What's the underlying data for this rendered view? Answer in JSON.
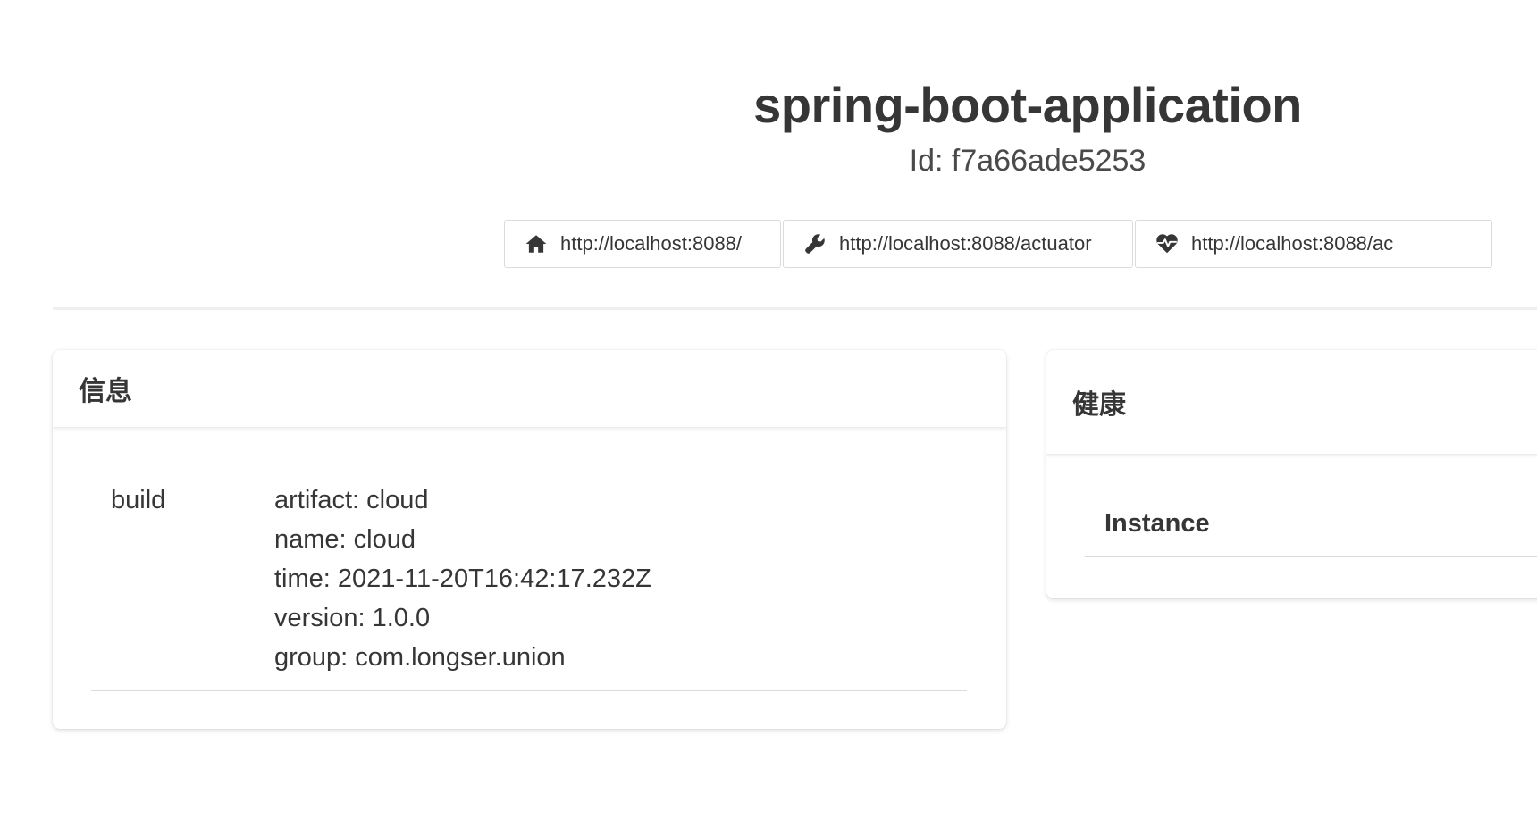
{
  "app": {
    "title": "spring-boot-application",
    "id_label": "Id: f7a66ade5253"
  },
  "links": [
    {
      "icon": "home-icon",
      "url": "http://localhost:8088/"
    },
    {
      "icon": "wrench-icon",
      "url": "http://localhost:8088/actuator"
    },
    {
      "icon": "heartbeat-icon",
      "url": "http://localhost:8088/ac"
    }
  ],
  "info_card": {
    "title": "信息",
    "entries": [
      {
        "key": "build",
        "values": [
          "artifact: cloud",
          "name: cloud",
          "time: 2021-11-20T16:42:17.232Z",
          "version: 1.0.0",
          "group: com.longser.union"
        ]
      }
    ]
  },
  "health_card": {
    "title": "健康",
    "instance_label": "Instance"
  }
}
